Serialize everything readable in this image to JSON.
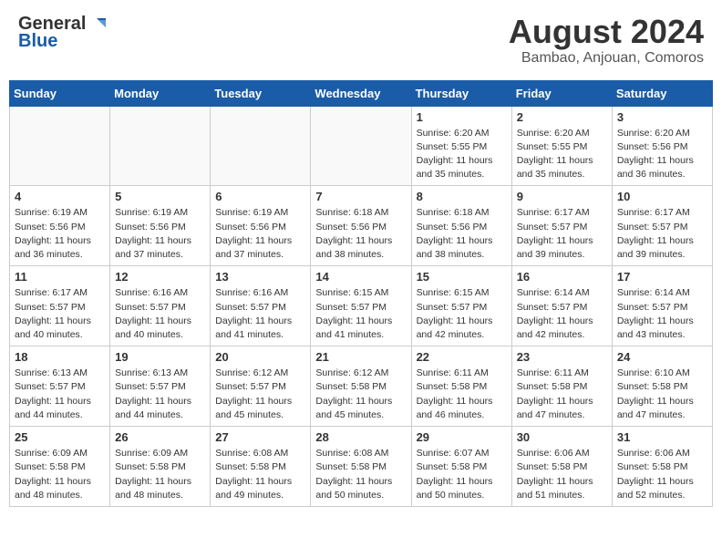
{
  "header": {
    "logo_line1": "General",
    "logo_line2": "Blue",
    "month": "August 2024",
    "location": "Bambao, Anjouan, Comoros"
  },
  "weekdays": [
    "Sunday",
    "Monday",
    "Tuesday",
    "Wednesday",
    "Thursday",
    "Friday",
    "Saturday"
  ],
  "weeks": [
    [
      {
        "day": "",
        "info": ""
      },
      {
        "day": "",
        "info": ""
      },
      {
        "day": "",
        "info": ""
      },
      {
        "day": "",
        "info": ""
      },
      {
        "day": "1",
        "info": "Sunrise: 6:20 AM\nSunset: 5:55 PM\nDaylight: 11 hours and 35 minutes."
      },
      {
        "day": "2",
        "info": "Sunrise: 6:20 AM\nSunset: 5:55 PM\nDaylight: 11 hours and 35 minutes."
      },
      {
        "day": "3",
        "info": "Sunrise: 6:20 AM\nSunset: 5:56 PM\nDaylight: 11 hours and 36 minutes."
      }
    ],
    [
      {
        "day": "4",
        "info": "Sunrise: 6:19 AM\nSunset: 5:56 PM\nDaylight: 11 hours and 36 minutes."
      },
      {
        "day": "5",
        "info": "Sunrise: 6:19 AM\nSunset: 5:56 PM\nDaylight: 11 hours and 37 minutes."
      },
      {
        "day": "6",
        "info": "Sunrise: 6:19 AM\nSunset: 5:56 PM\nDaylight: 11 hours and 37 minutes."
      },
      {
        "day": "7",
        "info": "Sunrise: 6:18 AM\nSunset: 5:56 PM\nDaylight: 11 hours and 38 minutes."
      },
      {
        "day": "8",
        "info": "Sunrise: 6:18 AM\nSunset: 5:56 PM\nDaylight: 11 hours and 38 minutes."
      },
      {
        "day": "9",
        "info": "Sunrise: 6:17 AM\nSunset: 5:57 PM\nDaylight: 11 hours and 39 minutes."
      },
      {
        "day": "10",
        "info": "Sunrise: 6:17 AM\nSunset: 5:57 PM\nDaylight: 11 hours and 39 minutes."
      }
    ],
    [
      {
        "day": "11",
        "info": "Sunrise: 6:17 AM\nSunset: 5:57 PM\nDaylight: 11 hours and 40 minutes."
      },
      {
        "day": "12",
        "info": "Sunrise: 6:16 AM\nSunset: 5:57 PM\nDaylight: 11 hours and 40 minutes."
      },
      {
        "day": "13",
        "info": "Sunrise: 6:16 AM\nSunset: 5:57 PM\nDaylight: 11 hours and 41 minutes."
      },
      {
        "day": "14",
        "info": "Sunrise: 6:15 AM\nSunset: 5:57 PM\nDaylight: 11 hours and 41 minutes."
      },
      {
        "day": "15",
        "info": "Sunrise: 6:15 AM\nSunset: 5:57 PM\nDaylight: 11 hours and 42 minutes."
      },
      {
        "day": "16",
        "info": "Sunrise: 6:14 AM\nSunset: 5:57 PM\nDaylight: 11 hours and 42 minutes."
      },
      {
        "day": "17",
        "info": "Sunrise: 6:14 AM\nSunset: 5:57 PM\nDaylight: 11 hours and 43 minutes."
      }
    ],
    [
      {
        "day": "18",
        "info": "Sunrise: 6:13 AM\nSunset: 5:57 PM\nDaylight: 11 hours and 44 minutes."
      },
      {
        "day": "19",
        "info": "Sunrise: 6:13 AM\nSunset: 5:57 PM\nDaylight: 11 hours and 44 minutes."
      },
      {
        "day": "20",
        "info": "Sunrise: 6:12 AM\nSunset: 5:57 PM\nDaylight: 11 hours and 45 minutes."
      },
      {
        "day": "21",
        "info": "Sunrise: 6:12 AM\nSunset: 5:58 PM\nDaylight: 11 hours and 45 minutes."
      },
      {
        "day": "22",
        "info": "Sunrise: 6:11 AM\nSunset: 5:58 PM\nDaylight: 11 hours and 46 minutes."
      },
      {
        "day": "23",
        "info": "Sunrise: 6:11 AM\nSunset: 5:58 PM\nDaylight: 11 hours and 47 minutes."
      },
      {
        "day": "24",
        "info": "Sunrise: 6:10 AM\nSunset: 5:58 PM\nDaylight: 11 hours and 47 minutes."
      }
    ],
    [
      {
        "day": "25",
        "info": "Sunrise: 6:09 AM\nSunset: 5:58 PM\nDaylight: 11 hours and 48 minutes."
      },
      {
        "day": "26",
        "info": "Sunrise: 6:09 AM\nSunset: 5:58 PM\nDaylight: 11 hours and 48 minutes."
      },
      {
        "day": "27",
        "info": "Sunrise: 6:08 AM\nSunset: 5:58 PM\nDaylight: 11 hours and 49 minutes."
      },
      {
        "day": "28",
        "info": "Sunrise: 6:08 AM\nSunset: 5:58 PM\nDaylight: 11 hours and 50 minutes."
      },
      {
        "day": "29",
        "info": "Sunrise: 6:07 AM\nSunset: 5:58 PM\nDaylight: 11 hours and 50 minutes."
      },
      {
        "day": "30",
        "info": "Sunrise: 6:06 AM\nSunset: 5:58 PM\nDaylight: 11 hours and 51 minutes."
      },
      {
        "day": "31",
        "info": "Sunrise: 6:06 AM\nSunset: 5:58 PM\nDaylight: 11 hours and 52 minutes."
      }
    ]
  ]
}
